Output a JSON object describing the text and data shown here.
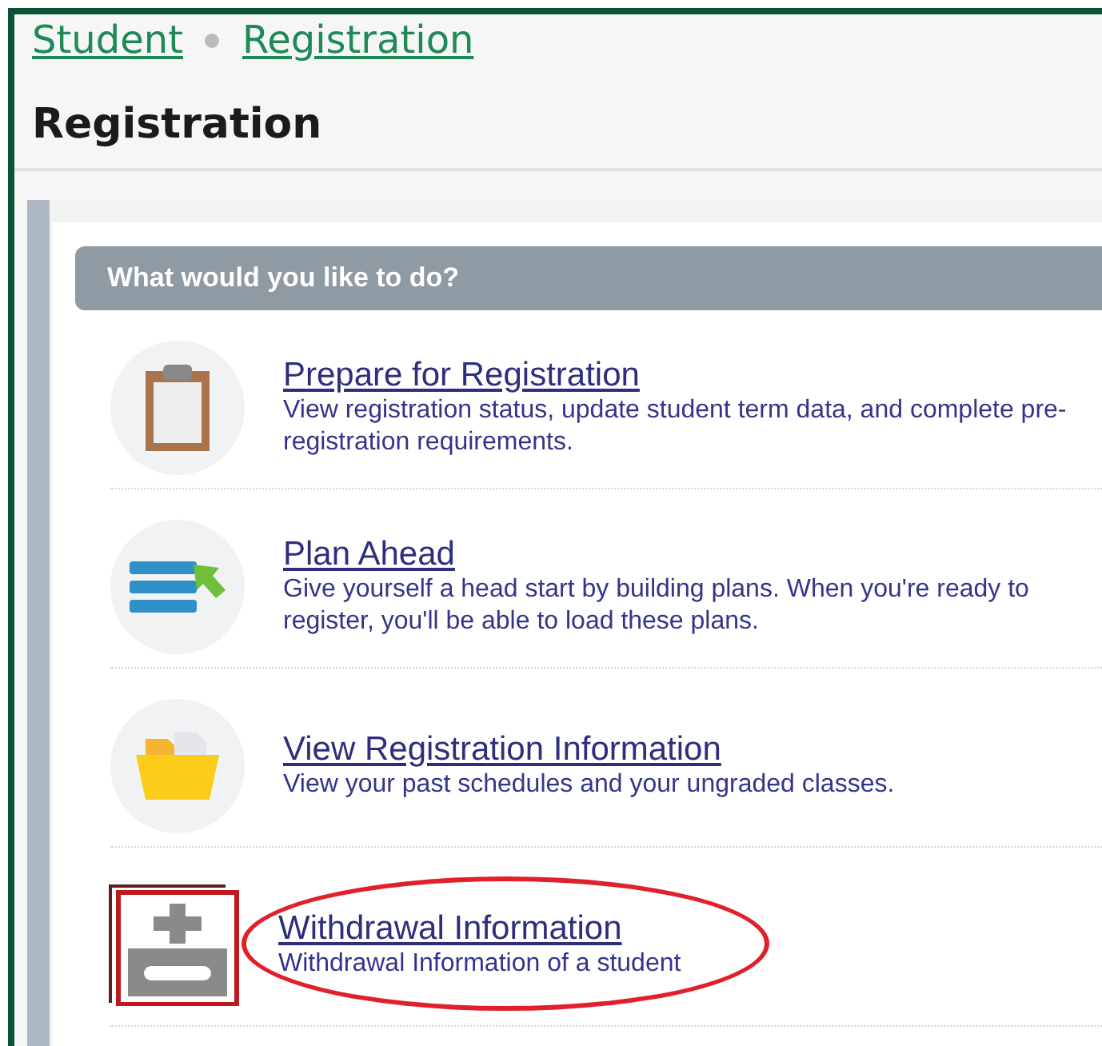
{
  "breadcrumb": [
    "Student",
    "Registration"
  ],
  "page_title": "Registration",
  "panel": {
    "heading": "What would you like to do?",
    "items": [
      {
        "kind": "clipboard",
        "title": "Prepare for Registration",
        "description": "View registration status, update student term data, and complete pre-registration requirements.",
        "highlighted": false
      },
      {
        "kind": "plan",
        "title": "Plan Ahead",
        "description": "Give yourself a head start by building plans. When you're ready to register, you'll be able to load these plans.",
        "highlighted": false
      },
      {
        "kind": "folder",
        "title": "View Registration Information",
        "description": "View your past schedules and your ungraded classes.",
        "highlighted": false
      },
      {
        "kind": "withdrawal",
        "title": "Withdrawal Information",
        "description": "Withdrawal Information of a student",
        "highlighted": true
      }
    ]
  }
}
